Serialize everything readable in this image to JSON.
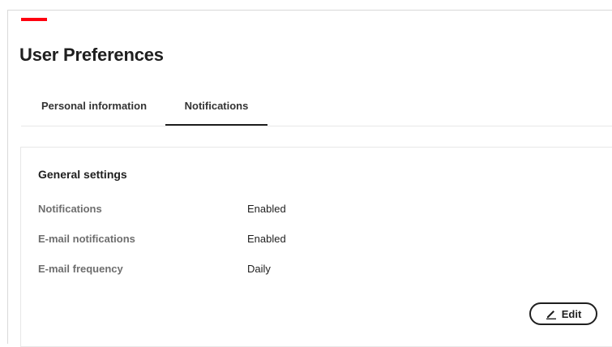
{
  "page": {
    "title": "User Preferences"
  },
  "tabs": [
    {
      "label": "Personal information",
      "active": false
    },
    {
      "label": "Notifications",
      "active": true
    }
  ],
  "card": {
    "title": "General settings",
    "rows": [
      {
        "label": "Notifications",
        "value": "Enabled"
      },
      {
        "label": "E-mail notifications",
        "value": "Enabled"
      },
      {
        "label": "E-mail frequency",
        "value": "Daily"
      }
    ],
    "edit_label": "Edit"
  },
  "colors": {
    "accent": "#ff000f",
    "text": "#1f1f1f",
    "label": "#6e6e6e",
    "border": "#e8e8e8"
  },
  "icons": {
    "edit": "pencil-icon"
  }
}
